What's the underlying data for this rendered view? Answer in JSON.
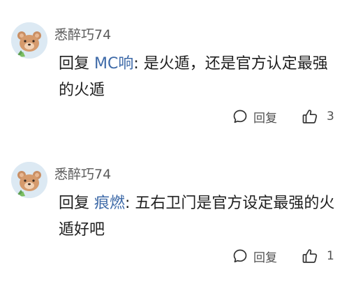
{
  "comments": [
    {
      "username": "悉醉巧74",
      "reply_prefix": "回复 ",
      "reply_target": "MC响",
      "separator": ": ",
      "text": "是火遁，还是官方认定最强的火遁",
      "actions": {
        "reply_label": "回复",
        "like_count": "3"
      },
      "icons": {
        "avatar": "bear-avatar",
        "reply": "speech-bubble-icon",
        "like": "thumbs-up-icon"
      }
    },
    {
      "username": "悉醉巧74",
      "reply_prefix": "回复 ",
      "reply_target": "痕燃",
      "separator": ": ",
      "text": "五右卫门是官方设定最强的火遁好吧",
      "actions": {
        "reply_label": "回复",
        "like_count": "1"
      },
      "icons": {
        "avatar": "bear-avatar",
        "reply": "speech-bubble-icon",
        "like": "thumbs-up-icon"
      }
    }
  ],
  "colors": {
    "background": "#ffffff",
    "text": "#1f1f1f",
    "username": "#5b5b5b",
    "reply_target": "#3e6aa8",
    "action_text": "#505050",
    "avatar_bg": "#dce9f3"
  }
}
